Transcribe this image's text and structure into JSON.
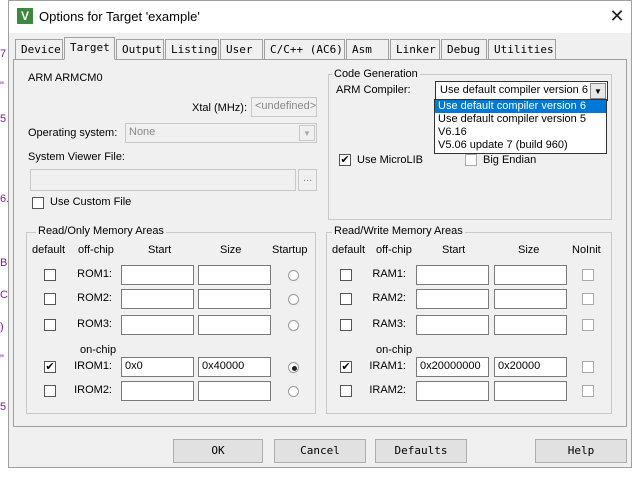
{
  "window": {
    "title": "Options for Target 'example'",
    "app_icon": "V",
    "close_glyph": "✕"
  },
  "edge_glyphs": [
    "7",
    "\"",
    "5",
    "6.",
    "B",
    "C",
    ")",
    "\"",
    "5"
  ],
  "tabs": [
    {
      "label": "Device",
      "active": false
    },
    {
      "label": "Target",
      "active": true
    },
    {
      "label": "Output",
      "active": false
    },
    {
      "label": "Listing",
      "active": false
    },
    {
      "label": "User",
      "active": false
    },
    {
      "label": "C/C++ (AC6)",
      "active": false
    },
    {
      "label": "Asm",
      "active": false
    },
    {
      "label": "Linker",
      "active": false
    },
    {
      "label": "Debug",
      "active": false
    },
    {
      "label": "Utilities",
      "active": false
    }
  ],
  "target": {
    "device_name": "ARM ARMCM0",
    "xtal_label": "Xtal (MHz):",
    "xtal_value": "<undefined>",
    "os_label": "Operating system:",
    "os_value": "None",
    "svf_label": "System Viewer File:",
    "svf_value": "",
    "browse_label": "...",
    "custom_file_label": "Use Custom File",
    "custom_file_checked": false
  },
  "code_generation": {
    "title": "Code Generation",
    "compiler_label": "ARM Compiler:",
    "compiler_value": "Use default compiler version 6",
    "options": [
      "Use default compiler version 6",
      "Use default compiler version 5",
      "V6.16",
      "V5.06 update 7 (build 960)"
    ],
    "selected_index": 0,
    "microlib_label": "Use MicroLIB",
    "microlib_checked": true,
    "big_endian_label": "Big Endian",
    "big_endian_checked": false
  },
  "ro_memory": {
    "title": "Read/Only Memory Areas",
    "headers": {
      "default": "default",
      "offchip": "off-chip",
      "start": "Start",
      "size": "Size",
      "extra": "Startup"
    },
    "onchip_label": "on-chip",
    "rows": [
      {
        "name": "ROM1:",
        "checked": false,
        "start": "",
        "size": "",
        "radio": false
      },
      {
        "name": "ROM2:",
        "checked": false,
        "start": "",
        "size": "",
        "radio": false
      },
      {
        "name": "ROM3:",
        "checked": false,
        "start": "",
        "size": "",
        "radio": false
      },
      {
        "name": "IROM1:",
        "checked": true,
        "start": "0x0",
        "size": "0x40000",
        "radio": true
      },
      {
        "name": "IROM2:",
        "checked": false,
        "start": "",
        "size": "",
        "radio": false
      }
    ]
  },
  "rw_memory": {
    "title": "Read/Write Memory Areas",
    "headers": {
      "default": "default",
      "offchip": "off-chip",
      "start": "Start",
      "size": "Size",
      "extra": "NoInit"
    },
    "onchip_label": "on-chip",
    "rows": [
      {
        "name": "RAM1:",
        "checked": false,
        "start": "",
        "size": "",
        "noinit": false
      },
      {
        "name": "RAM2:",
        "checked": false,
        "start": "",
        "size": "",
        "noinit": false
      },
      {
        "name": "RAM3:",
        "checked": false,
        "start": "",
        "size": "",
        "noinit": false
      },
      {
        "name": "IRAM1:",
        "checked": true,
        "start": "0x20000000",
        "size": "0x20000",
        "noinit": false
      },
      {
        "name": "IRAM2:",
        "checked": false,
        "start": "",
        "size": "",
        "noinit": false
      }
    ]
  },
  "buttons": {
    "ok": "OK",
    "cancel": "Cancel",
    "defaults": "Defaults",
    "help": "Help"
  },
  "check_glyph": "✔",
  "icons": {
    "dropdown": "chevron-down-icon",
    "close": "close-icon",
    "app": "keil-uvision-icon"
  }
}
